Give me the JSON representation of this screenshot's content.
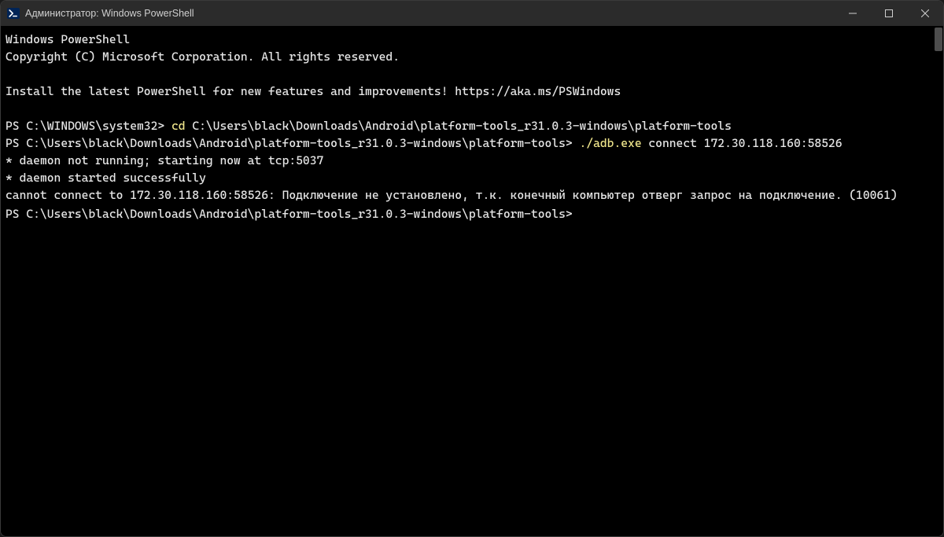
{
  "titlebar": {
    "title": "Администратор: Windows PowerShell"
  },
  "terminal": {
    "lines": [
      {
        "segments": [
          {
            "t": "Windows PowerShell",
            "c": "cmd-white"
          }
        ]
      },
      {
        "segments": [
          {
            "t": "Copyright (C) Microsoft Corporation. All rights reserved.",
            "c": "cmd-white"
          }
        ]
      },
      {
        "segments": [
          {
            "t": "",
            "c": "cmd-white"
          }
        ]
      },
      {
        "segments": [
          {
            "t": "Install the latest PowerShell for new features and improvements! https://aka.ms/PSWindows",
            "c": "cmd-white"
          }
        ]
      },
      {
        "segments": [
          {
            "t": "",
            "c": "cmd-white"
          }
        ]
      },
      {
        "segments": [
          {
            "t": "PS C:\\WINDOWS\\system32> ",
            "c": "cmd-white"
          },
          {
            "t": "cd ",
            "c": "cmd-yellow"
          },
          {
            "t": "C:\\Users\\black\\Downloads\\Android\\platform-tools_r31.0.3-windows\\platform-tools",
            "c": "cmd-white"
          }
        ]
      },
      {
        "segments": [
          {
            "t": "PS C:\\Users\\black\\Downloads\\Android\\platform-tools_r31.0.3-windows\\platform-tools> ",
            "c": "cmd-white"
          },
          {
            "t": "./adb.exe ",
            "c": "cmd-yellow"
          },
          {
            "t": "connect 172.30.118.160:58526",
            "c": "cmd-white"
          }
        ]
      },
      {
        "segments": [
          {
            "t": "* daemon not running; starting now at tcp:5037",
            "c": "cmd-white"
          }
        ]
      },
      {
        "segments": [
          {
            "t": "* daemon started successfully",
            "c": "cmd-white"
          }
        ]
      },
      {
        "segments": [
          {
            "t": "cannot connect to 172.30.118.160:58526: Подключение не установлено, т.к. конечный компьютер отверг запрос на подключение. (10061)",
            "c": "cmd-white"
          }
        ]
      },
      {
        "segments": [
          {
            "t": "PS C:\\Users\\black\\Downloads\\Android\\platform-tools_r31.0.3-windows\\platform-tools> ",
            "c": "cmd-white"
          }
        ],
        "cursor": true
      }
    ]
  }
}
